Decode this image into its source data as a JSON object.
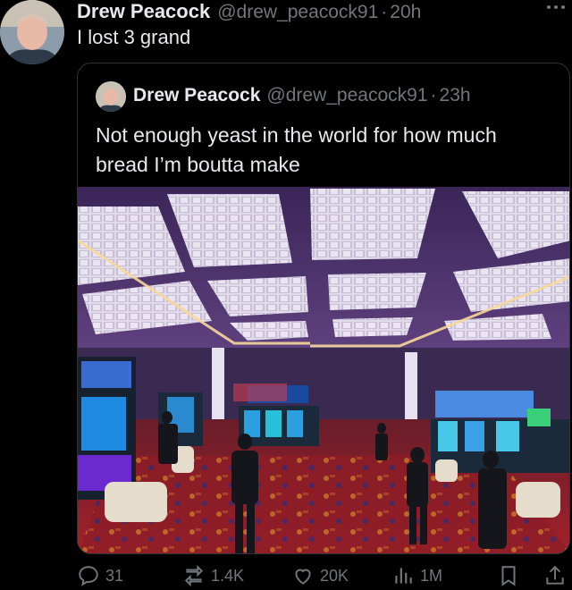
{
  "tweet": {
    "author_name": "Drew Peacock",
    "handle": "@drew_peacock91",
    "separator": "·",
    "time": "20h",
    "text": "I lost 3 grand",
    "more_icon": "ellipsis-icon"
  },
  "quoted": {
    "author_name": "Drew Peacock",
    "handle": "@drew_peacock91",
    "separator": "·",
    "time": "23h",
    "text": "Not enough yeast in the world for how much bread I’m boutta make",
    "media_description_icon": "casino-photo"
  },
  "actions": {
    "replies": "31",
    "reposts": "1.4K",
    "likes": "20K",
    "views": "1M"
  },
  "colors": {
    "background": "#000000",
    "text": "#e7e9ea",
    "secondary": "#71767b",
    "border": "#2f3336"
  }
}
